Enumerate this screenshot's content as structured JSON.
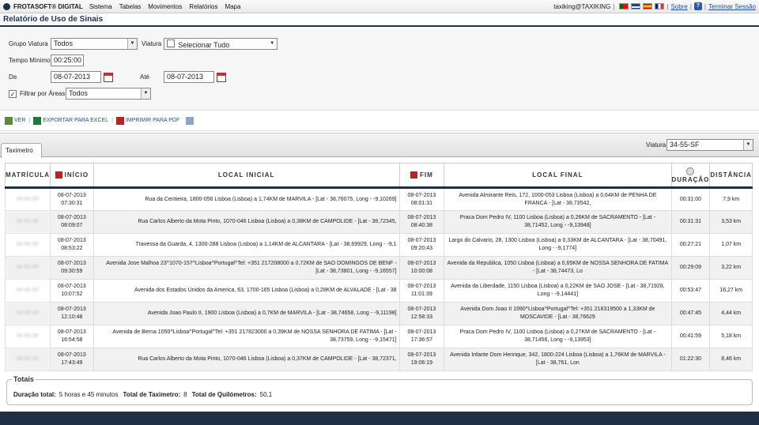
{
  "app": {
    "name": "FROTASOFT® DIGITAL"
  },
  "menu": [
    "Sistema",
    "Tabelas",
    "Movimentos",
    "Relatórios",
    "Mapa"
  ],
  "user": {
    "name": "taxiking@TAXIKING"
  },
  "links": {
    "sobre": "Sobre",
    "logout": "Terminar Sessão"
  },
  "page": {
    "title": "Relatório de Uso de Sinais"
  },
  "filters": {
    "grupo_label": "Grupo Viatura",
    "grupo_value": "Todos",
    "viatura_label": "Viatura",
    "viatura_value": "Selecionar Tudo",
    "tempo_label": "Tempo Mínimo",
    "tempo_value": "00:25:00",
    "de_label": "De",
    "de_value": "08-07-2013",
    "ate_label": "Até",
    "ate_value": "08-07-2013",
    "areas_label": "Filtrar por Áreas",
    "areas_value": "Todos"
  },
  "toolbar": {
    "ver": "VER",
    "excel": "EXPORTAR PARA EXCEL",
    "pdf": "IMPRIMIR PARA PDF"
  },
  "tabs": {
    "taximetro": "Taximetro"
  },
  "viatura_select": {
    "label": "Viatura",
    "value": "34-55-SF"
  },
  "table": {
    "headers": {
      "matricula": "MATRÍCULA",
      "inicio": "INÍCIO",
      "local_inicial": "LOCAL INICIAL",
      "fim": "FIM",
      "local_final": "LOCAL FINAL",
      "duracao": "DURAÇÃO",
      "distancia": "DISTÂNCIA"
    },
    "rows": [
      {
        "plate": "34-55-SF",
        "inicio": "08-07-2013 07:30:31",
        "local_inicial": "Rua da Centieira, 1800-056 Lisboa (Lisboa) a 1,74KM de MARVILA - [Lat - 38,76075, Long - -9,10269]",
        "fim": "08-07-2013 08:01:31",
        "local_final": "Avenida Almirante Reis, 172, 1000-053 Lisboa (Lisboa) a 0,64KM de PENHA DE FRANCA - [Lat - 38,73542,",
        "duracao": "00:31:00",
        "distancia": "7,9 km"
      },
      {
        "plate": "34-55-SF",
        "inicio": "08-07-2013 08:09:07",
        "local_inicial": "Rua Carlos Alberto da Mota Pinto, 1070-046 Lisboa (Lisboa) a 0,38KM de CAMPOLIDE - [Lat - 38,72345,",
        "fim": "08-07-2013 08:40:38",
        "local_final": "Praca Dom Pedro IV, 1100 Lisboa (Lisboa) a 0,26KM de SACRAMENTO - [Lat - 38,71452, Long - -9,13948]",
        "duracao": "00:31:31",
        "distancia": "3,53 km"
      },
      {
        "plate": "34-55-SF",
        "inicio": "08-07-2013 08:53:22",
        "local_inicial": "Travessa da Guarda, 4, 1300-288 Lisboa (Lisboa) a 1,14KM de ALCANTARA - [Lat - 38,69929, Long - -9,1",
        "fim": "08-07-2013 09:20:43",
        "local_final": "Largo do Calvario, 28, 1300 Lisboa (Lisboa) a 0,33KM de ALCANTARA - [Lat - 38,70491, Long - -9,1774]",
        "duracao": "00:27:21",
        "distancia": "1,07 km"
      },
      {
        "plate": "34-55-SF",
        "inicio": "08-07-2013 09:30:59",
        "local_inicial": "Avenida Jose Malhoa 23^1070-157^Lisboa^Portugal^Tel: +351 217208000 a 0,72KM de SAO DOMINGOS DE BENF - [Lat - 38,73801, Long - -9,16557]",
        "fim": "08-07-2013 10:00:08",
        "local_final": "Avenida da Republica, 1050 Lisboa (Lisboa) a 0,65KM de NOSSA SENHORA DE FATIMA - [Lat - 38,74473, Lo",
        "duracao": "00:29:09",
        "distancia": "3,22 km"
      },
      {
        "plate": "34-55-SF",
        "inicio": "08-07-2013 10:07:52",
        "local_inicial": "Avenida dos Estados Unidos da America, 63, 1700-165 Lisboa (Lisboa) a 0,28KM de ALVALADE - [Lat - 38",
        "fim": "08-07-2013 11:01:39",
        "local_final": "Avenida da Liberdade, 1150 Lisboa (Lisboa) a 0,22KM de SAO JOSE - [Lat - 38,71928, Long - -9,14441]",
        "duracao": "00:53:47",
        "distancia": "16,27 km"
      },
      {
        "plate": "34-55-SF",
        "inicio": "08-07-2013 12:10:48",
        "local_inicial": "Avenida Joao Paulo II, 1900 Lisboa (Lisboa) a 0,7KM de MARVILA - [Lat - 38,74658, Long - -9,11198]",
        "fim": "08-07-2013 12:58:33",
        "local_final": "Avenida Dom Joao II 1990^Lisboa^Portugal^Tel: +351 218319500 a 1,33KM de MOSCAVIDE - [Lat - 38,76629",
        "duracao": "00:47:45",
        "distancia": "4,44 km"
      },
      {
        "plate": "34-55-SF",
        "inicio": "08-07-2013 16:54:58",
        "local_inicial": "Avenida de Berna 1050^Lisboa^Portugal^Tel: +351 217823000 a 0,39KM de NOSSA SENHORA DE FATIMA - [Lat - 38,73759, Long - -9,15471]",
        "fim": "08-07-2013 17:36:57",
        "local_final": "Praca Dom Pedro IV, 1100 Lisboa (Lisboa) a 0,27KM de SACRAMENTO - [Lat - 38,71456, Long - -9,13953]",
        "duracao": "00:41:59",
        "distancia": "5,18 km"
      },
      {
        "plate": "34-55-SF",
        "inicio": "08-07-2013 17:43:49",
        "local_inicial": "Rua Carlos Alberto da Mota Pinto, 1070-046 Lisboa (Lisboa) a 0,37KM de CAMPOLIDE - [Lat - 38,72371,",
        "fim": "08-07-2013 19:06:19",
        "local_final": "Avenida Infante Dom Henrique, 342, 1800-224 Lisboa (Lisboa) a 1,76KM de MARVILA - [Lat - 38,761, Lon",
        "duracao": "01:22:30",
        "distancia": "8,46 km"
      }
    ]
  },
  "totals": {
    "title": "Totais",
    "duracao_label": "Duração total:",
    "duracao_value": "5 horas e 45 minutos",
    "taximetro_label": "Total de Taximetro:",
    "taximetro_value": "8",
    "km_label": "Total de Quilómetros:",
    "km_value": "50,1"
  }
}
